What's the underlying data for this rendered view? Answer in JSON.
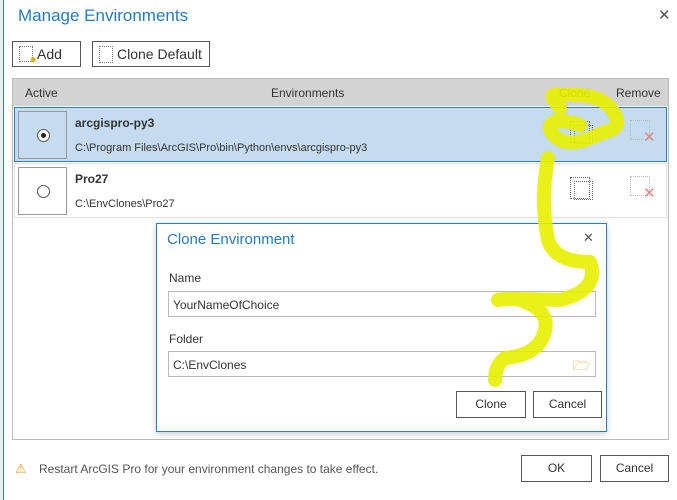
{
  "window": {
    "title": "Manage Environments"
  },
  "toolbar": {
    "add_label": "Add",
    "clone_default_label": "Clone Default"
  },
  "list": {
    "headers": {
      "active": "Active",
      "environments": "Environments",
      "clone": "Clone",
      "remove": "Remove"
    },
    "rows": [
      {
        "name": "arcgispro-py3",
        "path": "C:\\Program Files\\ArcGIS\\Pro\\bin\\Python\\envs\\arcgispro-py3",
        "active": true
      },
      {
        "name": "Pro27",
        "path": "C:\\EnvClones\\Pro27",
        "active": false
      }
    ]
  },
  "clone_dialog": {
    "title": "Clone Environment",
    "name_label": "Name",
    "name_value": "YourNameOfChoice",
    "folder_label": "Folder",
    "folder_value": "C:\\EnvClones",
    "clone_label": "Clone",
    "cancel_label": "Cancel"
  },
  "footer": {
    "warning": "Restart ArcGIS Pro for your environment changes to take effect.",
    "ok_label": "OK",
    "cancel_label": "Cancel"
  },
  "colors": {
    "accent": "#2a7ab9",
    "selected_row": "#c5dbf0",
    "annotation": "#e6f000"
  }
}
